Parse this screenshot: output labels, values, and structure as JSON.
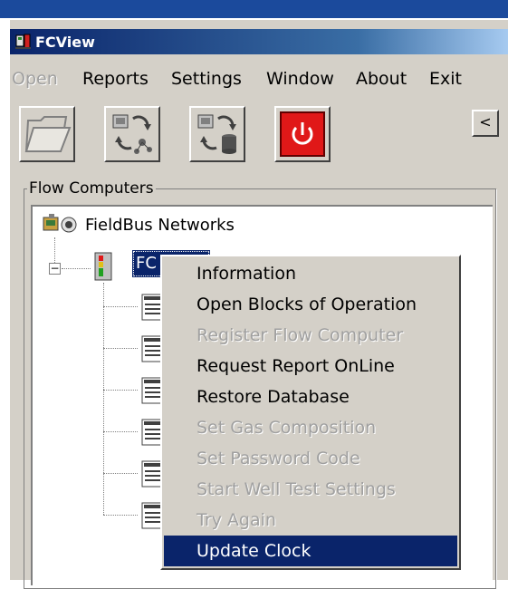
{
  "window": {
    "title": "FCView"
  },
  "menu": {
    "items": [
      {
        "label": "Open",
        "enabled": false
      },
      {
        "label": "Reports",
        "enabled": true
      },
      {
        "label": "Settings",
        "enabled": true
      },
      {
        "label": "Window",
        "enabled": true
      },
      {
        "label": "About",
        "enabled": true
      },
      {
        "label": "Exit",
        "enabled": true
      }
    ]
  },
  "toolbar": {
    "buttons": [
      {
        "icon": "open-folder-icon"
      },
      {
        "icon": "network-refresh-icon"
      },
      {
        "icon": "database-sync-icon"
      },
      {
        "icon": "power-icon"
      }
    ],
    "collapse_label": "<"
  },
  "group": {
    "label": "Flow Computers"
  },
  "tree": {
    "root_label": "FieldBus Networks",
    "node_label": "FC",
    "child_count": 6
  },
  "context_menu": {
    "items": [
      {
        "label": "Information",
        "enabled": true,
        "selected": false
      },
      {
        "label": "Open Blocks of Operation",
        "enabled": true,
        "selected": false
      },
      {
        "label": "Register Flow Computer",
        "enabled": false,
        "selected": false
      },
      {
        "label": "Request Report OnLine",
        "enabled": true,
        "selected": false
      },
      {
        "label": "Restore Database",
        "enabled": true,
        "selected": false
      },
      {
        "label": "Set Gas Composition",
        "enabled": false,
        "selected": false
      },
      {
        "label": "Set Password Code",
        "enabled": false,
        "selected": false
      },
      {
        "label": "Start Well Test Settings",
        "enabled": false,
        "selected": false
      },
      {
        "label": "Try Again",
        "enabled": false,
        "selected": false
      },
      {
        "label": "Update Clock",
        "enabled": true,
        "selected": true
      }
    ]
  },
  "colors": {
    "selection": "#0a246a",
    "face": "#d4d0c8",
    "power_button": "#e01818"
  }
}
